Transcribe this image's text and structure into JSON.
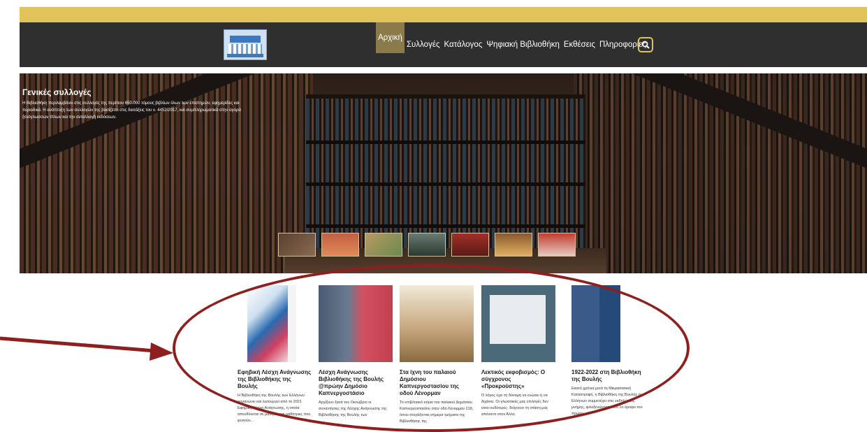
{
  "nav": {
    "items": [
      "Αρχική",
      "Συλλογές",
      "Κατάλογος",
      "Ψηφιακή Βιβλιοθήκη",
      "Εκθέσεις",
      "Πληροφορίες"
    ],
    "active": "Αρχική",
    "search_icon": "search-icon"
  },
  "hero": {
    "title": "Γενικές συλλογές",
    "description": "Η Βιβλιοθήκη περιλαμβάνει στις συλλογές της περίπου 650.000 τόμους βιβλίων όλων των επιστημών, εφημερίδες και περιοδικά. Η ανάπτυξη των συλλογών της βασίζεται στις διατάξεις του ν. 4452/2017, και συμπληρωματικά στην αγορά ξενόγλωσσων τίτλων και την ανταλλαγή εκδόσεων."
  },
  "cards": [
    {
      "title": "Εφηβική Λέσχη Ανάγνωσης της Βιβλιοθήκης της Βουλής",
      "text": "Η Βιβλιοθήκη της Βουλής των Ελλήνων οργανώνει και λειτουργεί από το 2021 Εφηβική Λέσχη Ανάγνωσης, η οποία απευθύνεται σε μαθητές και μαθήτριες που φοιτούν..."
    },
    {
      "title": "Λέσχη Ανάγνωσης Βιβλιοθήκης της Βουλής @πρώην Δημόσιο Καπνεργοστάσιο",
      "text": "Αρχίζουν ξανά τον Οκτώβριο οι συναντήσεις της Λέσχης Ανάγνωσης της Βιβλιοθήκης της Βουλής των"
    },
    {
      "title": "Στα ίχνη του παλαιού Δημόσιου Καπνεργοστασίου της οδού Λένορμαν",
      "text": "Το επιβλητικό κτίριο του παλαιού Δημόσιου Καπνεργοστασίου στην οδό Λένορμαν 218, όπου στεγάζονται σήμερα τμήματα της Βιβλιοθήκης της"
    },
    {
      "title": "Λεκτικός εκφοβισμός: Ο σύγχρονος «Προκρούστης»",
      "text": "Ο λόγος έχει τη δύναμη να ενώσει ή να διχάσει. Οι γλωσσικές μας επιλογές δεν είναι ουδέτερες· δείχνουν τη στάση μας απέναντι στον Άλλο."
    },
    {
      "title": "1922-2022 στη Βιβλιοθήκη της Βουλής",
      "text": "Εκατό χρόνια μετά τη Μικρασιατική Καταστροφή, η Βιβλιοθήκη της Βουλής των Ελλήνων συμμετέχει στις εκδηλώσεις μνήμης, φιλοξενώντας στον 1ο όροφο του πρώην..."
    }
  ],
  "colors": {
    "topbar": "#e2c35a",
    "navbar": "#2f2f2f",
    "annotation": "#8e1f1f"
  }
}
